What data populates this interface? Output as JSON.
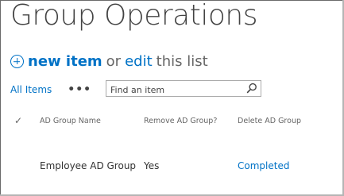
{
  "page": {
    "title": "Group Operations"
  },
  "commands": {
    "new_item_label": "new item",
    "or_text": "or",
    "edit_label": "edit",
    "this_list_text": "this list"
  },
  "view": {
    "all_items_label": "All Items",
    "more_label": "•••",
    "search_placeholder": "Find an item"
  },
  "table": {
    "columns": [
      "AD Group Name",
      "Remove AD Group?",
      "Delete AD Group"
    ],
    "rows": [
      {
        "ad_group_name": "Employee AD Group",
        "remove_ad_group": "Yes",
        "delete_ad_group": "Completed"
      }
    ]
  },
  "colors": {
    "accent": "#0072c6",
    "title": "#444444",
    "muted": "#666666"
  }
}
